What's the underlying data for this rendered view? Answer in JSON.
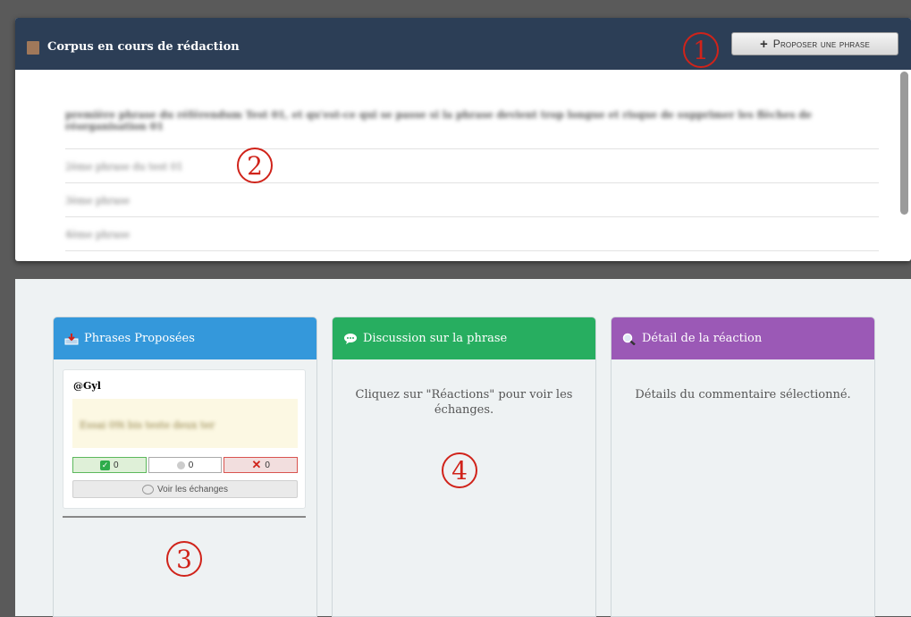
{
  "corpus": {
    "title": "Corpus en cours de rédaction",
    "propose_button": "Proposer une phrase",
    "sentences": [
      "première phrase du référendum Test 01, et qu'est-ce qui se passe si la phrase devient trop longue et risque de supprimer les flèches de réorganisation 01",
      "2ème phrase du test 01",
      "3ème phrase",
      "4ème phrase"
    ]
  },
  "callouts": [
    "1",
    "2",
    "3",
    "4"
  ],
  "columns": {
    "proposed": {
      "title": "Phrases Proposées",
      "card": {
        "user": "@Gyl",
        "text": "Essai 09i bis teste deux ter",
        "votes": {
          "yes": "0",
          "neutral": "0",
          "no": "0"
        },
        "see_button": "Voir les échanges"
      }
    },
    "discussion": {
      "title": "Discussion sur la phrase",
      "message": "Cliquez sur \"Réactions\" pour voir les échanges."
    },
    "detail": {
      "title": "Détail de la réaction",
      "message": "Détails du commentaire sélectionné."
    }
  },
  "colors": {
    "header_bg": "#2c3e56",
    "blue": "#3498db",
    "green": "#27ae60",
    "purple": "#9b59b6",
    "callout": "#d0231a"
  },
  "icons": {
    "corpus": "book-icon",
    "proposed": "inbox-icon",
    "discussion": "speech-bubble-icon",
    "detail": "magnifier-icon"
  }
}
